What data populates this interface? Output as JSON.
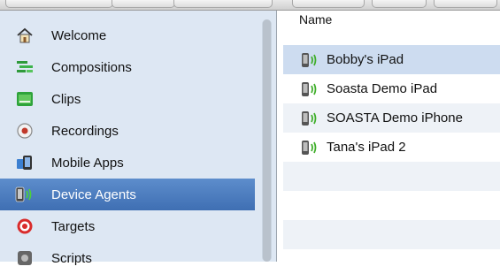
{
  "sidebar": {
    "items": [
      {
        "label": "Welcome",
        "icon": "home-icon"
      },
      {
        "label": "Compositions",
        "icon": "compositions-icon"
      },
      {
        "label": "Clips",
        "icon": "clips-icon"
      },
      {
        "label": "Recordings",
        "icon": "recordings-icon"
      },
      {
        "label": "Mobile Apps",
        "icon": "mobile-apps-icon"
      },
      {
        "label": "Device Agents",
        "icon": "device-agent-icon",
        "selected": true
      },
      {
        "label": "Targets",
        "icon": "targets-icon"
      },
      {
        "label": "Scripts",
        "icon": "scripts-icon"
      }
    ]
  },
  "list": {
    "header": "Name",
    "rows": [
      {
        "label": "Bobby's iPad",
        "selected": true
      },
      {
        "label": "Soasta Demo iPad"
      },
      {
        "label": "SOASTA Demo iPhone"
      },
      {
        "label": "Tana's iPad 2"
      }
    ]
  },
  "colors": {
    "sidebar_bg": "#dde7f3",
    "selection_blue": "#4a7bbf",
    "row_selected": "#cddcf0",
    "device_green": "#3fae2a"
  }
}
